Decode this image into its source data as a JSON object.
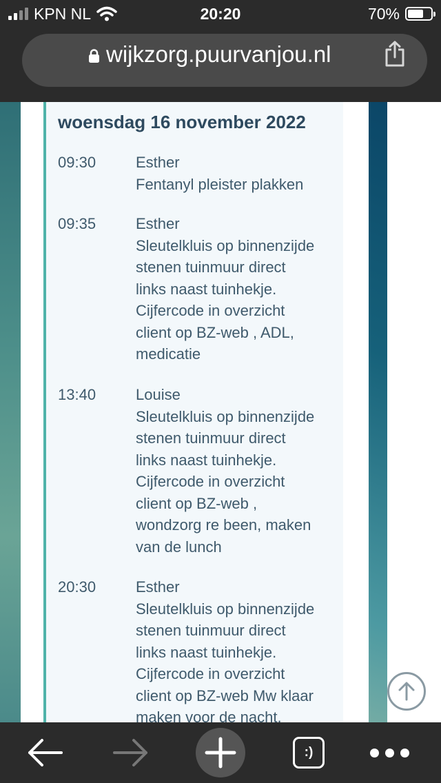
{
  "status_bar": {
    "carrier": "KPN NL",
    "time": "20:20",
    "battery_percent": "70%",
    "battery_level": 0.7
  },
  "url_bar": {
    "url": "wijkzorg.puurvanjou.nl"
  },
  "schedule": {
    "date_heading": "woensdag 16 november 2022",
    "entries": [
      {
        "time": "09:30",
        "lines": [
          "Esther",
          "Fentanyl pleister plakken"
        ]
      },
      {
        "time": "09:35",
        "lines": [
          "Esther",
          "Sleutelkluis op binnenzijde",
          "stenen tuinmuur direct",
          "links naast tuinhekje.",
          "Cijfercode in overzicht",
          "client op BZ-web , ADL,",
          "medicatie"
        ]
      },
      {
        "time": "13:40",
        "lines": [
          "Louise",
          "Sleutelkluis op binnenzijde",
          "stenen tuinmuur direct",
          "links naast tuinhekje.",
          "Cijfercode in overzicht",
          "client op BZ-web ,",
          "wondzorg re been, maken",
          "van de lunch"
        ]
      },
      {
        "time": "20:30",
        "lines": [
          "Esther",
          "Sleutelkluis op binnenzijde",
          "stenen tuinmuur direct",
          "links naast tuinhekje.",
          "Cijfercode in overzicht",
          "client op BZ-web Mw klaar",
          "maken voor de nacht."
        ]
      }
    ]
  },
  "toolbar": {
    "tabs_label": ":)"
  },
  "icons": {
    "signal": "signal-strength-icon",
    "wifi": "wifi-icon",
    "battery": "battery-icon",
    "lock": "lock-icon",
    "share": "share-icon",
    "scroll_top": "arrow-up-circle-icon",
    "back": "arrow-left-icon",
    "forward": "arrow-right-icon",
    "new_tab": "plus-icon",
    "menu": "more-dots-icon"
  },
  "colors": {
    "chrome_bg": "#2b2b2b",
    "url_pill": "#4a4a4a",
    "panel_bg": "#f3f8fb",
    "panel_accent": "#4fb3a9",
    "heading_text": "#2e4a5f",
    "body_text": "#3f5a6c"
  }
}
